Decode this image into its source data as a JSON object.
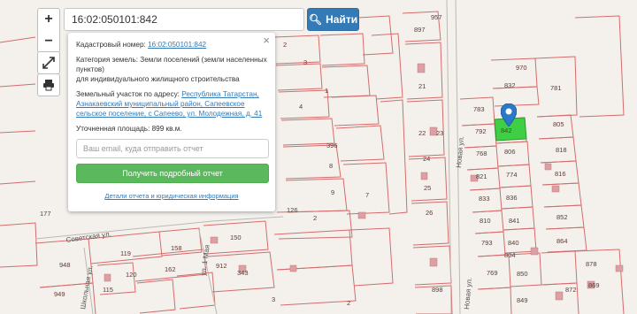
{
  "search": {
    "value": "16:02:050101:842",
    "button_label": "Найти"
  },
  "controls": {
    "zoom_in": "+",
    "zoom_out": "−"
  },
  "popup": {
    "cadastral_label": "Кадастровый номер:",
    "cadastral_value": "16:02:050101:842",
    "category_label": "Категория земель:",
    "category_value": "Земли поселений (земли населенных пунктов)",
    "category_extra": "для индивидуального жилищного строительства",
    "address_label": "Земельный участок по адресу:",
    "address_value": "Республика Татарстан, Азнакаевский муниципальный район, Сапеевское сельское поселение, с Сапеево, ул. Молодежная, д. 41",
    "area_label": "Уточненная площадь:",
    "area_value": "899 кв.м.",
    "email_placeholder": "Ваш email, куда отправить отчет",
    "report_button": "Получить подробный отчет",
    "details_link": "Детали отчета и юридическая информация",
    "close": "×"
  },
  "streets": [
    "Советская ул.",
    "Школьная ул.",
    "ул. 1 Мая",
    "Новая ул.",
    "Новая ул."
  ],
  "plots": [
    "897",
    "970",
    "2",
    "832",
    "781",
    "3",
    "1",
    "21",
    "783",
    "805",
    "4",
    "792",
    "22",
    "396",
    "23",
    "768",
    "806",
    "818",
    "24",
    "8",
    "821",
    "774",
    "816",
    "25",
    "9",
    "833",
    "836",
    "126",
    "26",
    "177",
    "2",
    "810",
    "841",
    "852",
    "150",
    "7",
    "793",
    "840",
    "864",
    "957",
    "119",
    "158",
    "912",
    "343",
    "804",
    "948",
    "949",
    "120",
    "115",
    "162",
    "878",
    "872",
    "3",
    "898",
    "769",
    "850",
    "869",
    "849",
    "2"
  ],
  "selected_plot": "842",
  "colors": {
    "selected_fill": "#3fcf45",
    "pin": "#2a78c8",
    "plot_border": "#d06a6a",
    "building": "#d99ca0"
  }
}
